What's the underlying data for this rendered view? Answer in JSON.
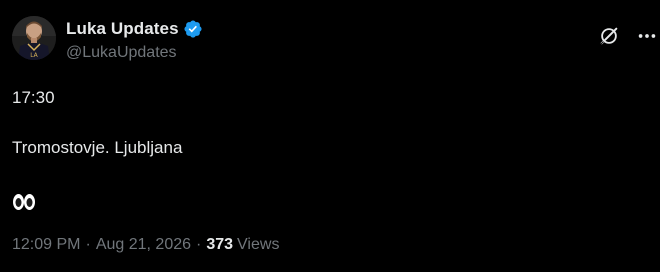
{
  "author": {
    "display_name": "Luka Updates",
    "handle": "@LukaUpdates",
    "verified": true,
    "verified_color": "#1d9bf0"
  },
  "header_icons": {
    "grok": "grok-icon",
    "more": "more-options-icon"
  },
  "content": {
    "line1": "17:30",
    "line2": "Tromostovje. Ljubljana",
    "line3_emoji": "eyes-emoji"
  },
  "meta": {
    "time": "12:09 PM",
    "separator": "·",
    "date": "Aug 21, 2026",
    "views_count": "373",
    "views_label": "Views"
  },
  "colors": {
    "background": "#000000",
    "primary_text": "#e7e9ea",
    "secondary_text": "#71767b"
  }
}
